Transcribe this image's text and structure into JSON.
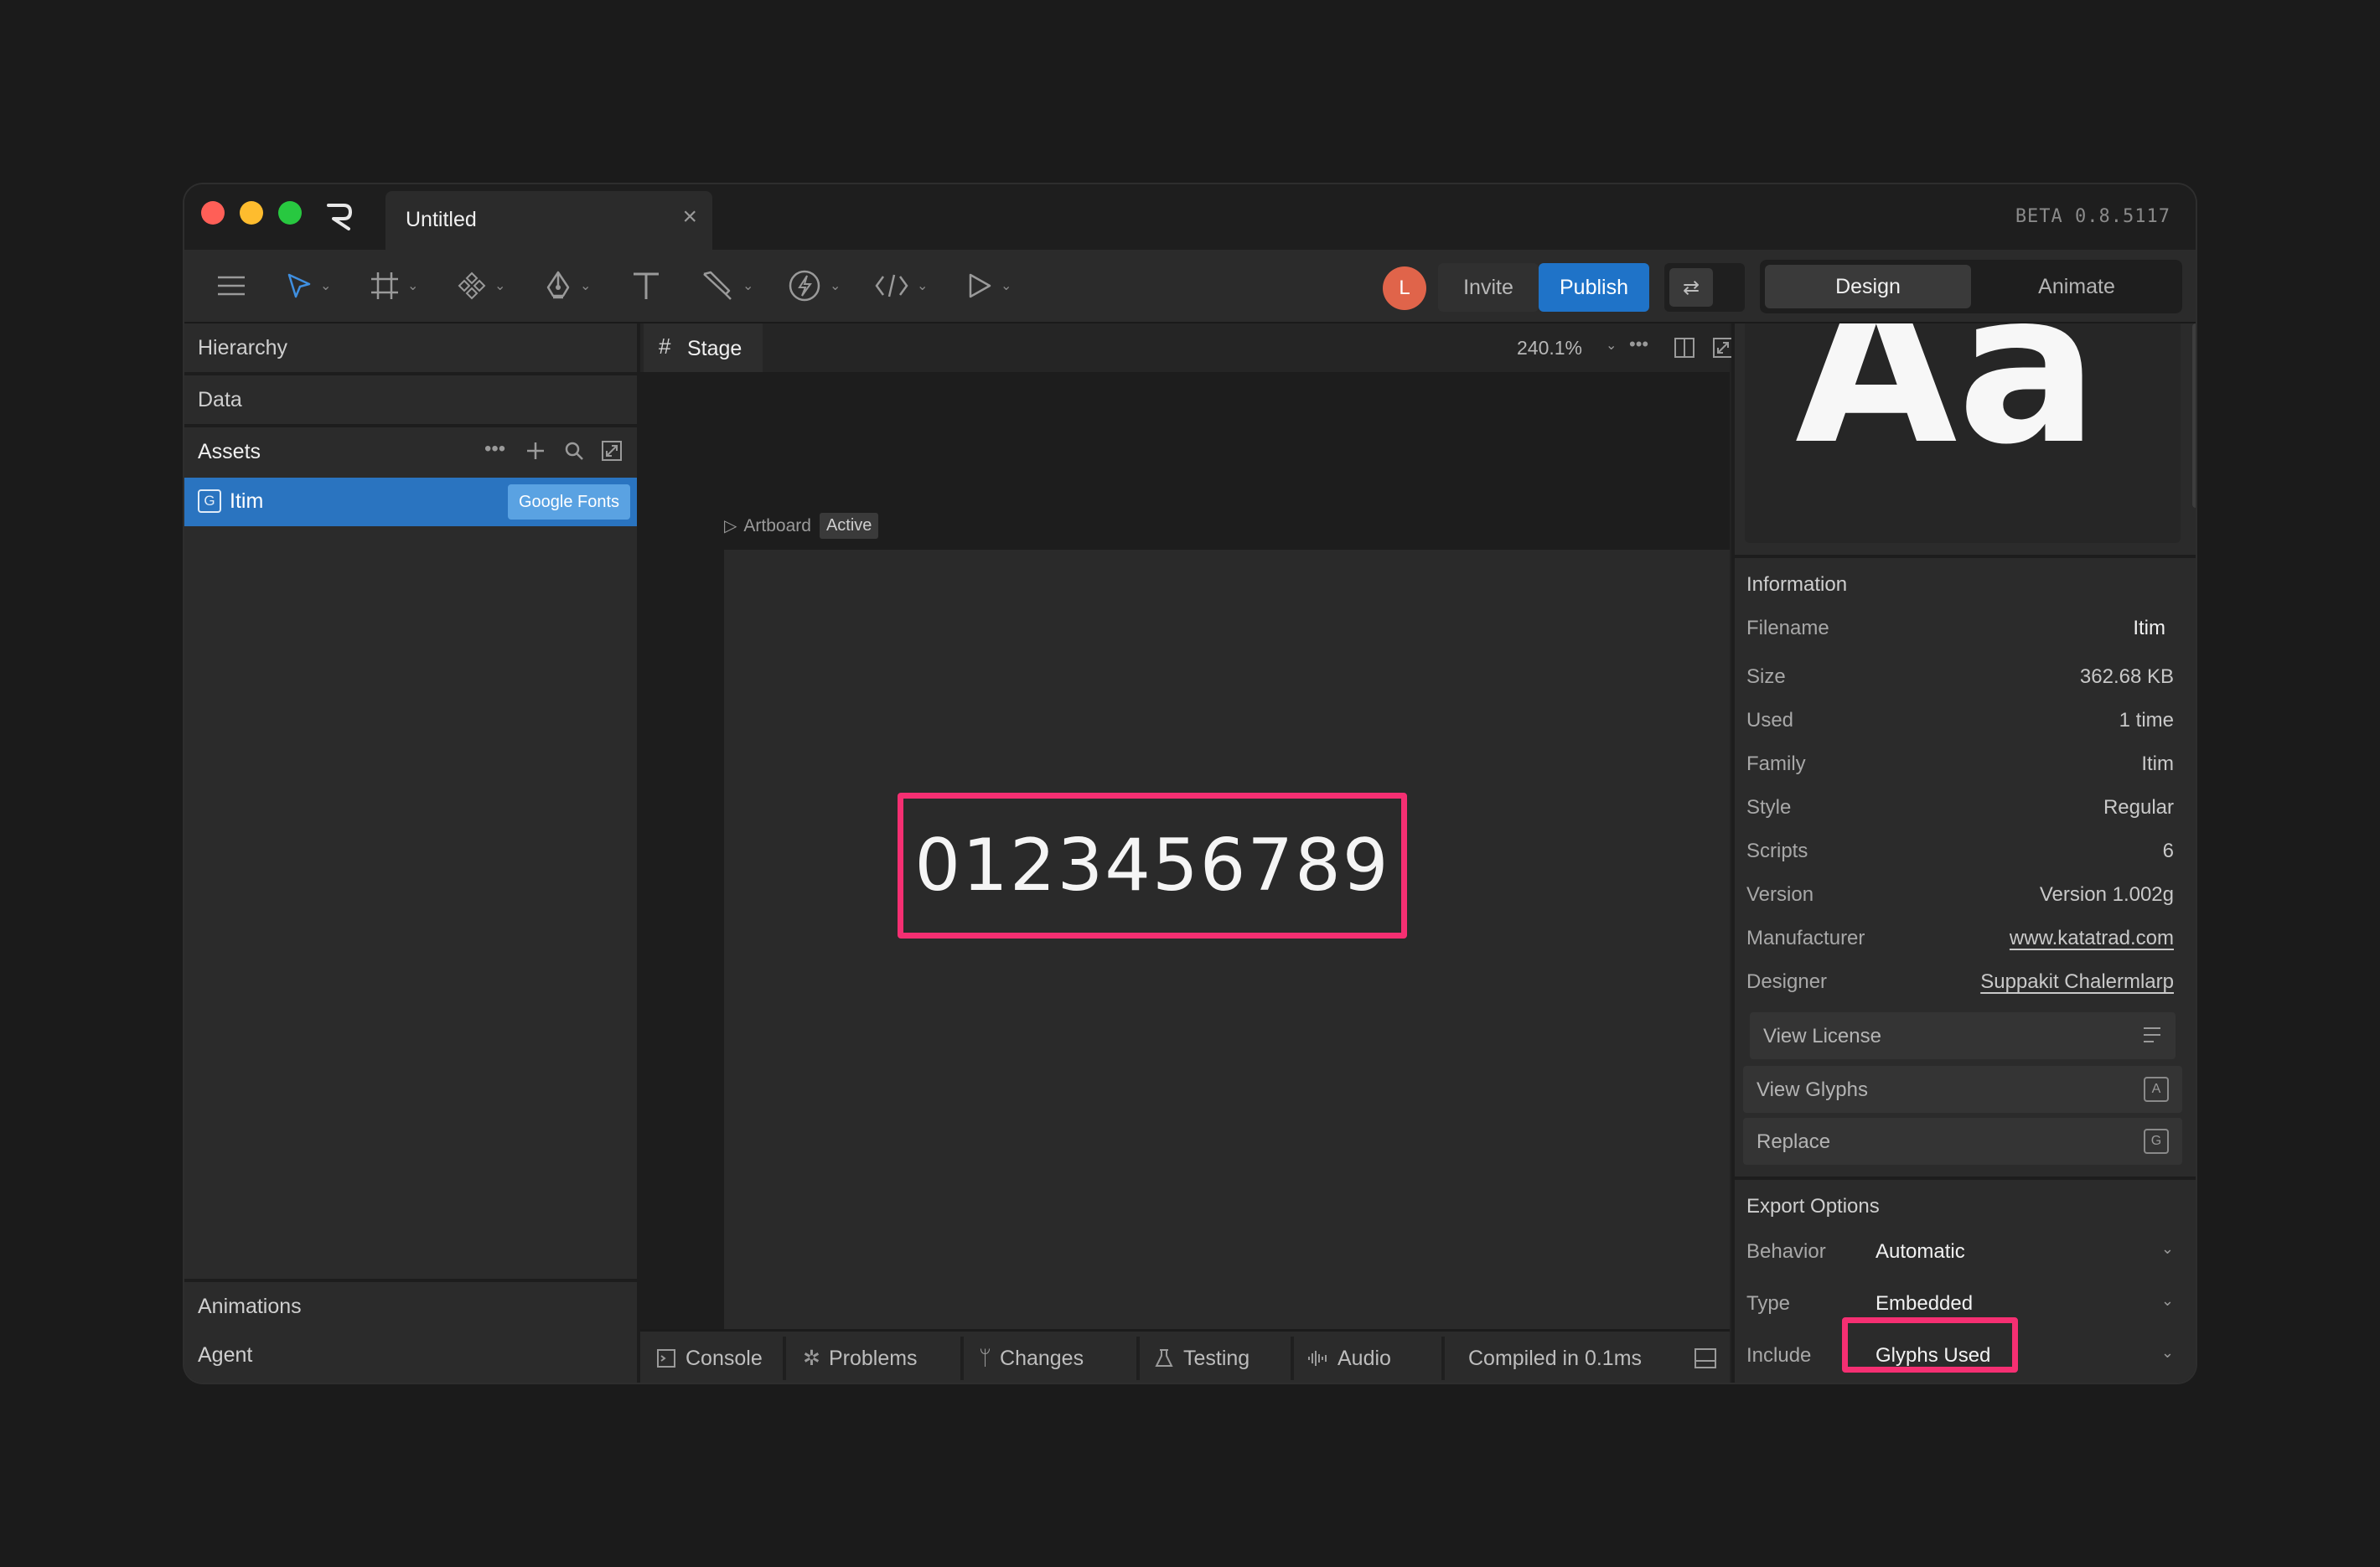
{
  "window": {
    "tab_title": "Untitled",
    "version": "BETA 0.8.5117"
  },
  "toolbar": {
    "avatar_initial": "L",
    "invite_label": "Invite",
    "publish_label": "Publish",
    "modes": [
      "Design",
      "Animate"
    ],
    "active_mode": "Design",
    "accent": "#1f73c8"
  },
  "left_panel": {
    "sections": [
      "Hierarchy",
      "Data",
      "Assets"
    ],
    "asset": {
      "name": "Itim",
      "source_badge": "Google Fonts"
    },
    "bottom_sections": [
      "Animations",
      "Agent"
    ]
  },
  "stage": {
    "tab_label": "Stage",
    "zoom": "240.1%",
    "artboard_label": "Artboard",
    "artboard_status": "Active",
    "text_content": "0123456789"
  },
  "bottom_bar": {
    "tabs": [
      "Console",
      "Problems",
      "Changes",
      "Testing",
      "Audio"
    ],
    "status": "Compiled in 0.1ms"
  },
  "right_panel": {
    "preview_text": "Aa",
    "information_title": "Information",
    "info": [
      {
        "key": "Filename",
        "value": "Itim"
      },
      {
        "key": "Size",
        "value": "362.68 KB"
      },
      {
        "key": "Used",
        "value": "1 time"
      },
      {
        "key": "Family",
        "value": "Itim"
      },
      {
        "key": "Style",
        "value": "Regular"
      },
      {
        "key": "Scripts",
        "value": "6"
      },
      {
        "key": "Version",
        "value": "Version 1.002g"
      },
      {
        "key": "Manufacturer",
        "value": "www.katatrad.com"
      },
      {
        "key": "Designer",
        "value": "Suppakit Chalermlarp"
      }
    ],
    "actions": [
      "View License",
      "View Glyphs",
      "Replace"
    ],
    "export_title": "Export Options",
    "export": [
      {
        "key": "Behavior",
        "value": "Automatic"
      },
      {
        "key": "Type",
        "value": "Embedded"
      },
      {
        "key": "Include",
        "value": "Glyphs Used"
      }
    ]
  },
  "highlight_color": "#f52f72"
}
